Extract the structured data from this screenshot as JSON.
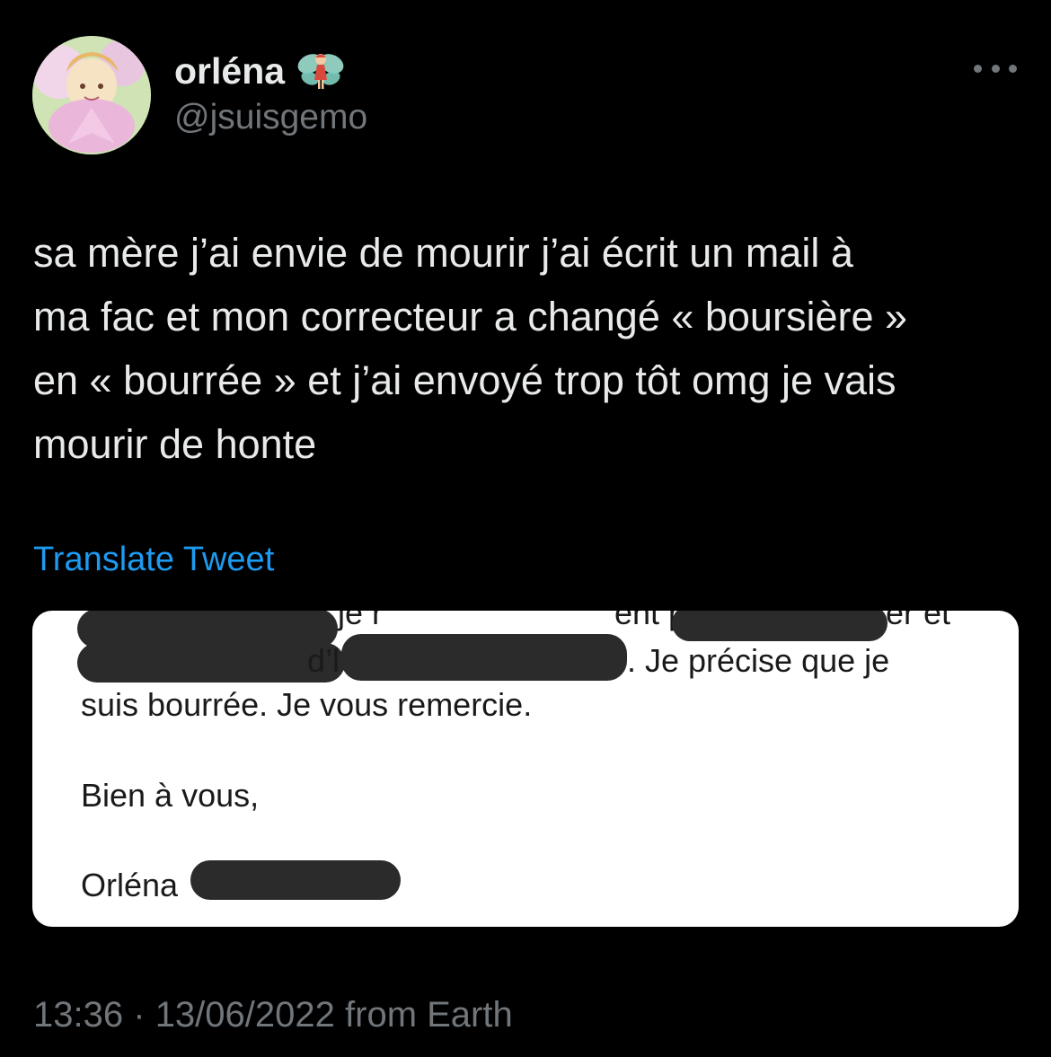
{
  "author": {
    "display_name": "orléna",
    "handle": "@jsuisgemo",
    "name_emoji": "fairy-icon"
  },
  "tweet": {
    "lines": [
      "sa mère j’ai envie de mourir j’ai écrit un mail à",
      "ma fac et mon correcteur a changé « boursière »",
      "en « bourrée » et j’ai envoyé trop tôt omg je vais",
      "mourir de honte"
    ],
    "translate_label": "Translate Tweet",
    "time": "13:36",
    "separator": "·",
    "date": "13/06/2022",
    "source": "from Earth"
  },
  "email_screenshot": {
    "line1_fragments": [
      "je r",
      "ent p",
      "er et"
    ],
    "line2_fragments": [
      "d’l",
      ". Je précise que je"
    ],
    "line3": "suis bourrée. Je vous remercie.",
    "closing": "Bien à vous,",
    "signature_first_name": "Orléna"
  },
  "colors": {
    "background": "#000000",
    "primary_text": "#e7e9ea",
    "secondary_text": "#71767b",
    "link": "#1d9bf0",
    "redaction": "#2b2b2b"
  }
}
